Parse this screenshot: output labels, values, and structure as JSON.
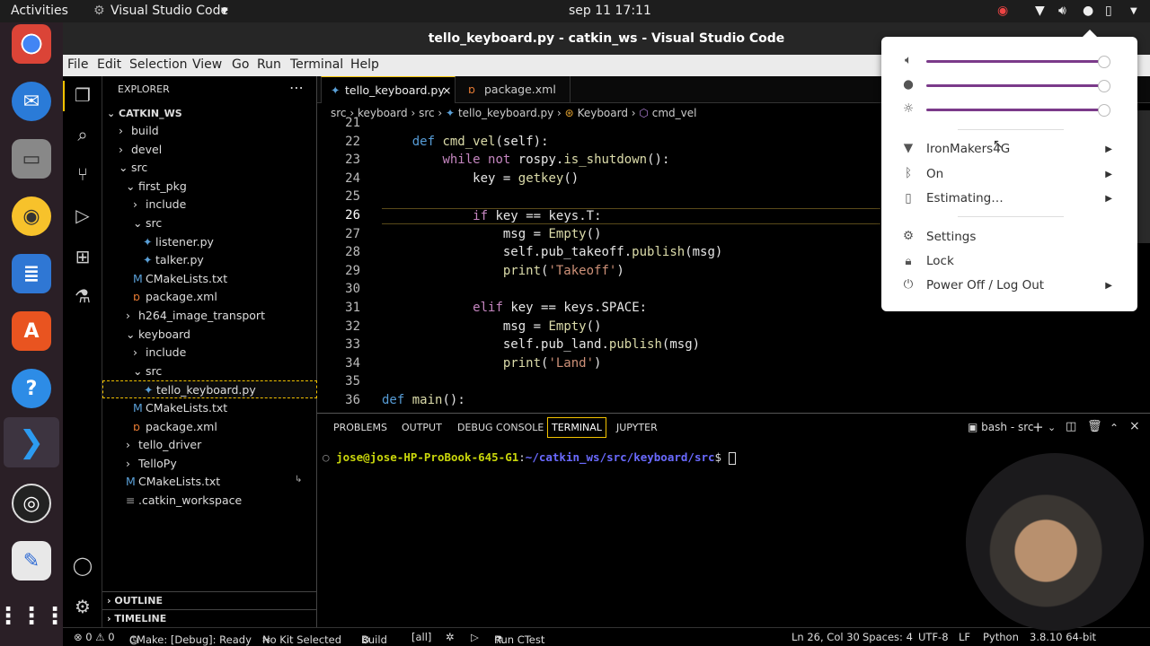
{
  "topbar": {
    "activities": "Activities",
    "app_menu": "Visual Studio Code",
    "clock": "sep 11  17:11"
  },
  "window": {
    "title": "tello_keyboard.py - catkin_ws - Visual Studio Code"
  },
  "menu": [
    "File",
    "Edit",
    "Selection",
    "View",
    "Go",
    "Run",
    "Terminal",
    "Help"
  ],
  "explorer": {
    "header": "EXPLORER",
    "root": "CATKIN_WS",
    "items": [
      {
        "label": "build",
        "indent": 0,
        "kind": "folder-closed"
      },
      {
        "label": "devel",
        "indent": 0,
        "kind": "folder-closed"
      },
      {
        "label": "src",
        "indent": 0,
        "kind": "folder-open"
      },
      {
        "label": "first_pkg",
        "indent": 1,
        "kind": "folder-open"
      },
      {
        "label": "include",
        "indent": 2,
        "kind": "folder-closed"
      },
      {
        "label": "src",
        "indent": 2,
        "kind": "folder-open"
      },
      {
        "label": "listener.py",
        "indent": 3,
        "kind": "py"
      },
      {
        "label": "talker.py",
        "indent": 3,
        "kind": "py"
      },
      {
        "label": "CMakeLists.txt",
        "indent": 2,
        "kind": "cmake"
      },
      {
        "label": "package.xml",
        "indent": 2,
        "kind": "xml"
      },
      {
        "label": "h264_image_transport",
        "indent": 1,
        "kind": "folder-closed"
      },
      {
        "label": "keyboard",
        "indent": 1,
        "kind": "folder-open"
      },
      {
        "label": "include",
        "indent": 2,
        "kind": "folder-closed"
      },
      {
        "label": "src",
        "indent": 2,
        "kind": "folder-open"
      },
      {
        "label": "tello_keyboard.py",
        "indent": 3,
        "kind": "py"
      },
      {
        "label": "CMakeLists.txt",
        "indent": 2,
        "kind": "cmake"
      },
      {
        "label": "package.xml",
        "indent": 2,
        "kind": "xml"
      },
      {
        "label": "tello_driver",
        "indent": 1,
        "kind": "folder-closed"
      },
      {
        "label": "TelloPy",
        "indent": 1,
        "kind": "folder-closed"
      },
      {
        "label": "CMakeLists.txt",
        "indent": 1,
        "kind": "cmake"
      },
      {
        "label": ".catkin_workspace",
        "indent": 1,
        "kind": "file"
      }
    ],
    "outline": "OUTLINE",
    "timeline": "TIMELINE"
  },
  "tabs": [
    {
      "label": "tello_keyboard.py",
      "close": "×"
    },
    {
      "label": "package.xml"
    }
  ],
  "breadcrumb": [
    "src",
    "keyboard",
    "src",
    "tello_keyboard.py",
    "Keyboard",
    "cmd_vel"
  ],
  "code_lines": [
    {
      "n": "21",
      "text": ""
    },
    {
      "n": "22",
      "text": "    def cmd_vel(self):"
    },
    {
      "n": "23",
      "text": "        while not rospy.is_shutdown():"
    },
    {
      "n": "24",
      "text": "            key = getkey()"
    },
    {
      "n": "25",
      "text": ""
    },
    {
      "n": "26",
      "text": "            if key == keys.T:"
    },
    {
      "n": "27",
      "text": "                msg = Empty()"
    },
    {
      "n": "28",
      "text": "                self.pub_takeoff.publish(msg)"
    },
    {
      "n": "29",
      "text": "                print('Takeoff')"
    },
    {
      "n": "30",
      "text": ""
    },
    {
      "n": "31",
      "text": "            elif key == keys.SPACE:"
    },
    {
      "n": "32",
      "text": "                msg = Empty()"
    },
    {
      "n": "33",
      "text": "                self.pub_land.publish(msg)"
    },
    {
      "n": "34",
      "text": "                print('Land')"
    },
    {
      "n": "35",
      "text": ""
    },
    {
      "n": "36",
      "text": "def main():"
    }
  ],
  "panel": {
    "tabs": [
      "PROBLEMS",
      "OUTPUT",
      "DEBUG CONSOLE",
      "TERMINAL",
      "JUPYTER"
    ],
    "shell": "bash - src",
    "prompt_user": "jose@jose-HP-ProBook-645-G1",
    "prompt_path": "~/catkin_ws/src/keyboard/src",
    "prompt_end": "$"
  },
  "status": {
    "problems": "⊗ 0 ⚠ 0",
    "cmake": "CMake: [Debug]: Ready",
    "kit": "No Kit Selected",
    "build": "Build",
    "target": "[all]",
    "ctest": "Run CTest",
    "position": "Ln 26, Col 30",
    "spaces": "Spaces: 4",
    "encoding": "UTF-8",
    "eol": "LF",
    "language": "Python",
    "interpreter": "3.8.10 64-bit"
  },
  "system_menu": {
    "volume_level": 0.98,
    "mic_level": 0.98,
    "brightness_level": 0.98,
    "wifi": "IronMakers4G",
    "bluetooth": "On",
    "battery": "Estimating…",
    "settings": "Settings",
    "lock": "Lock",
    "power": "Power Off / Log Out"
  },
  "colors": {
    "accent": "#7b3a8a",
    "keyword": "#c586c0",
    "keyword_def": "#569cd6",
    "string": "#ce9178",
    "function": "#dcdcaa",
    "prompt_user": "#c9d60b",
    "prompt_path": "#6a6aff"
  }
}
